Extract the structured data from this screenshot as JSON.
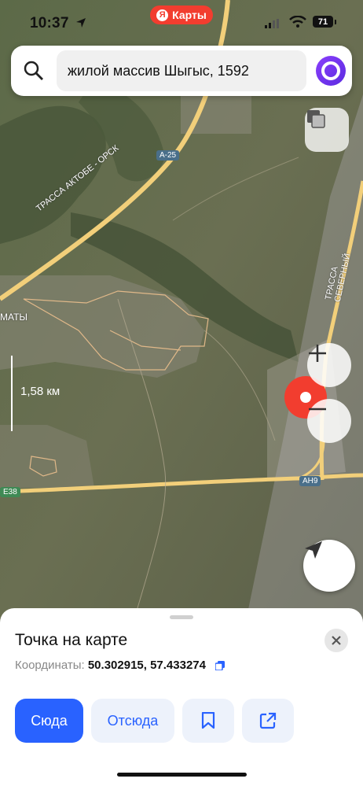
{
  "status_bar": {
    "time": "10:37",
    "app_name": "Карты",
    "app_logo_letter": "Я",
    "battery": "71"
  },
  "search": {
    "query": "жилой массив Шыгыс, 1592"
  },
  "map": {
    "scale_label": "1,58 км",
    "labels": {
      "road_aktobe_orsk": "ТРАССА АКТОБЕ - ОРСК",
      "road_severny": "ТРАССА СЕВЕРНЫЙ",
      "city_partial": "МАТЫ",
      "road_a25": "А-25",
      "road_ah9": "АН9",
      "road_e38": "E38"
    },
    "colors": {
      "road": "#f2cf7a",
      "pin": "#f23d2f"
    }
  },
  "sheet": {
    "title": "Точка на карте",
    "coords_label": "Координаты:",
    "coords_value": "50.302915, 57.433274",
    "buttons": {
      "here": "Сюда",
      "from": "Отсюда"
    }
  },
  "accent_color": "#2962ff"
}
